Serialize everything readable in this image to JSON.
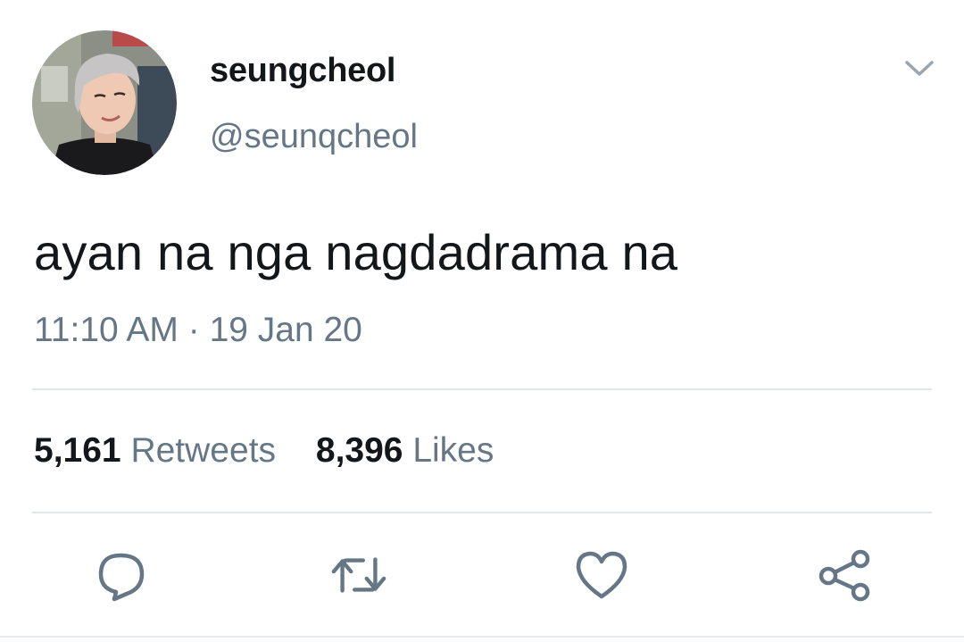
{
  "tweet": {
    "author": {
      "display_name": "seungcheol",
      "handle": "@seunqcheol"
    },
    "text": "ayan na nga nagdadrama na",
    "time": "11:10 AM",
    "separator": " · ",
    "date": "19 Jan 20",
    "stats": {
      "retweets_count": "5,161",
      "retweets_label": "Retweets",
      "likes_count": "8,396",
      "likes_label": "Likes"
    }
  },
  "icons": {
    "menu": "chevron-down-icon",
    "reply": "reply-icon",
    "retweet": "retweet-icon",
    "like": "heart-icon",
    "share": "share-icon"
  },
  "colors": {
    "primary_text": "#14171a",
    "secondary_text": "#657786",
    "icon": "#657786",
    "divider": "#e1e8ed"
  }
}
